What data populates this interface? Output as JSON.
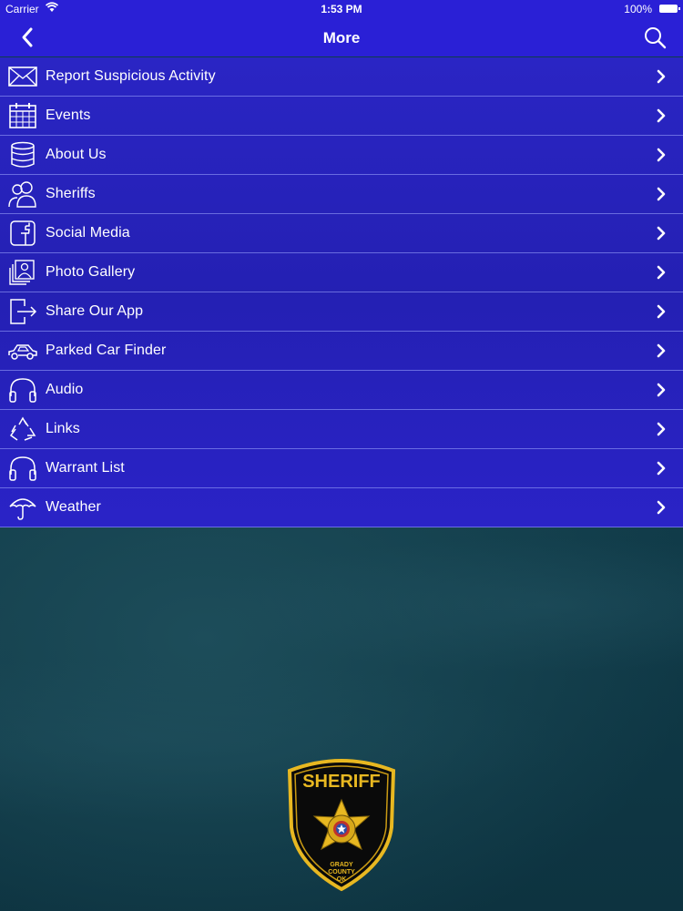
{
  "status_bar": {
    "carrier": "Carrier",
    "time": "1:53 PM",
    "battery": "100%"
  },
  "navbar": {
    "title": "More",
    "back_icon": "chevron-left-icon",
    "search_icon": "search-icon"
  },
  "menu": {
    "items": [
      {
        "label": "Report Suspicious Activity",
        "icon": "envelope-icon"
      },
      {
        "label": "Events",
        "icon": "calendar-icon"
      },
      {
        "label": "About Us",
        "icon": "database-icon"
      },
      {
        "label": "Sheriffs",
        "icon": "people-icon"
      },
      {
        "label": "Social Media",
        "icon": "facebook-icon"
      },
      {
        "label": "Photo Gallery",
        "icon": "photo-gallery-icon"
      },
      {
        "label": "Share Our App",
        "icon": "share-icon"
      },
      {
        "label": "Parked Car Finder",
        "icon": "car-icon"
      },
      {
        "label": "Audio",
        "icon": "headphones-icon"
      },
      {
        "label": "Links",
        "icon": "recycle-icon"
      },
      {
        "label": "Warrant List",
        "icon": "headphones-icon"
      },
      {
        "label": "Weather",
        "icon": "umbrella-icon"
      }
    ]
  },
  "badge": {
    "title": "SHERIFF",
    "line1": "GRADY",
    "line2": "COUNTY",
    "line3": "OK"
  },
  "colors": {
    "nav_bar": "#2a20d6",
    "menu_bg": "#2420b3",
    "page_bg": "#123f4d",
    "badge_gold": "#e8b821"
  }
}
